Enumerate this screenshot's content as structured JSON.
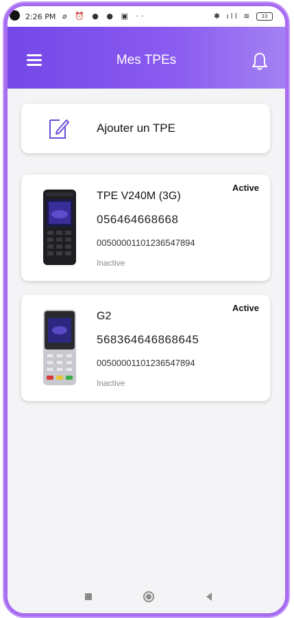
{
  "status_bar": {
    "time": "2:26 PM",
    "left_icons": "⌀ ⏰ ● ● ▣ ··",
    "right_icons": "✱ ıll ≋",
    "battery": "33"
  },
  "app_bar": {
    "title": "Mes TPEs",
    "menu_icon": "hamburger-menu-icon",
    "bell_icon": "bell-icon"
  },
  "add_card": {
    "label": "Ajouter un TPE",
    "icon": "edit-icon"
  },
  "tpes": [
    {
      "name": "TPE V240M (3G)",
      "serial": "056464668668",
      "code": "0050000110123654789​4",
      "status": "Inactive",
      "badge": "Active"
    },
    {
      "name": "G2",
      "serial": "568364646868645",
      "code": "0050000110123654789​4",
      "status": "Inactive",
      "badge": "Active"
    }
  ],
  "colors": {
    "accent": "#7447e8",
    "accent_light": "#a381f3",
    "frame": "#a86cf0"
  }
}
